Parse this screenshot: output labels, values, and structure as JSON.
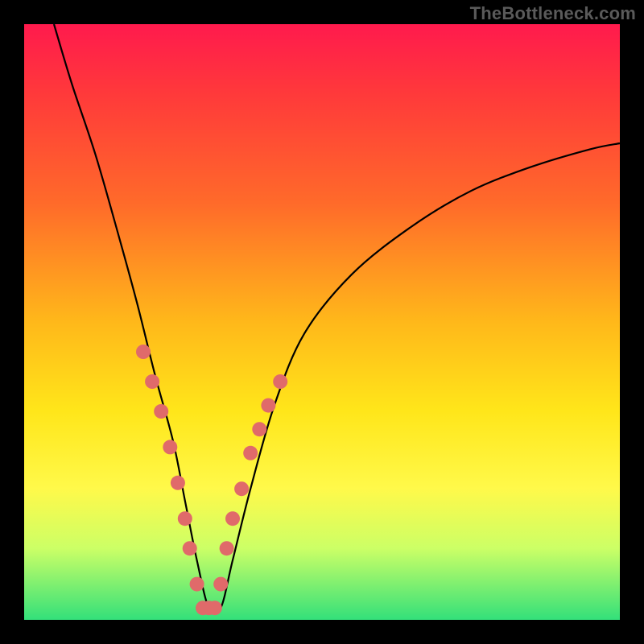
{
  "watermark": "TheBottleneck.com",
  "chart_data": {
    "type": "line",
    "title": "",
    "xlabel": "",
    "ylabel": "",
    "xlim": [
      0,
      100
    ],
    "ylim": [
      0,
      100
    ],
    "series": [
      {
        "name": "bottleneck-curve",
        "x": [
          5,
          8,
          12,
          16,
          19,
          22,
          25,
          27,
          29,
          31,
          33,
          35,
          38,
          42,
          47,
          55,
          65,
          75,
          85,
          95,
          100
        ],
        "values": [
          100,
          90,
          78,
          64,
          53,
          41,
          30,
          20,
          10,
          2,
          2,
          10,
          22,
          36,
          48,
          58,
          66,
          72,
          76,
          79,
          80
        ]
      }
    ],
    "markers": {
      "name": "highlighted-points",
      "color": "#e06a6a",
      "x": [
        20,
        21.5,
        23,
        24.5,
        25.8,
        27,
        27.8,
        29,
        30,
        31,
        32,
        33,
        34,
        35,
        36.5,
        38,
        39.5,
        41,
        43
      ],
      "values": [
        45,
        40,
        35,
        29,
        23,
        17,
        12,
        6,
        2,
        2,
        2,
        6,
        12,
        17,
        22,
        28,
        32,
        36,
        40
      ]
    },
    "gradient": {
      "type": "vertical",
      "stops": [
        {
          "pos": 0.0,
          "color": "#ff1a4d"
        },
        {
          "pos": 0.12,
          "color": "#ff3a3a"
        },
        {
          "pos": 0.3,
          "color": "#ff6a2a"
        },
        {
          "pos": 0.5,
          "color": "#ffb81a"
        },
        {
          "pos": 0.65,
          "color": "#ffe61a"
        },
        {
          "pos": 0.78,
          "color": "#fff94a"
        },
        {
          "pos": 0.88,
          "color": "#ccff66"
        },
        {
          "pos": 1.0,
          "color": "#33e07a"
        }
      ]
    }
  }
}
